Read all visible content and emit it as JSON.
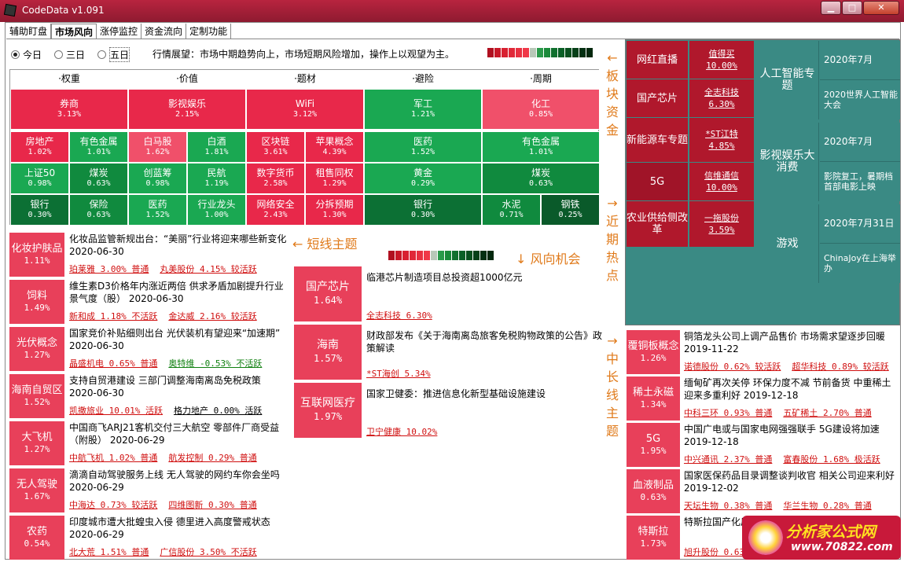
{
  "window": {
    "title": "CodeData v1.091"
  },
  "tabs": [
    "辅助盯盘",
    "市场风向",
    "涨停监控",
    "资金流向",
    "定制功能"
  ],
  "radios": [
    {
      "label": "今日",
      "on": true
    },
    {
      "label": "三日",
      "on": false
    },
    {
      "label": "五日",
      "on": false
    }
  ],
  "forecast": "行情展望：市场中期趋势向上，市场短期风险增加，操作上以观望为主。",
  "side_labels": {
    "sector_funds": "←板块资金",
    "recent_hot": "→近期热点",
    "long_theme": "→中长线主题"
  },
  "grid_headers": [
    "·权重",
    "·价值",
    "·题材",
    "·避险",
    "·周期"
  ],
  "grid_cells": [
    {
      "name": "券商",
      "pct": "3.13%",
      "color": "#e8284a"
    },
    {
      "name": "影视娱乐",
      "pct": "2.15%",
      "color": "#e8284a"
    },
    {
      "name": "WiFi",
      "pct": "3.12%",
      "color": "#e8284a"
    },
    {
      "name": "军工",
      "pct": "1.21%",
      "color": "#1aa852"
    },
    {
      "name": "化工",
      "pct": "0.85%",
      "color": "#f0506a"
    },
    {
      "name": "房地产",
      "pct": "1.02%",
      "color": "#e8284a"
    },
    {
      "name": "有色金属",
      "pct": "1.01%",
      "color": "#1aa852"
    },
    {
      "name": "白马股",
      "pct": "1.62%",
      "color": "#f0506a"
    },
    {
      "name": "白酒",
      "pct": "1.81%",
      "color": "#1aa852"
    },
    {
      "name": "区块链",
      "pct": "3.61%",
      "color": "#e8284a"
    },
    {
      "name": "苹果概念",
      "pct": "4.39%",
      "color": "#e8284a"
    },
    {
      "name": "医药",
      "pct": "1.52%",
      "color": "#1aa852"
    },
    {
      "name": "有色金属",
      "pct": "1.01%",
      "color": "#1aa852"
    },
    {
      "name": "上证50",
      "pct": "0.98%",
      "color": "#1aa852"
    },
    {
      "name": "煤炭",
      "pct": "0.63%",
      "color": "#108a3e"
    },
    {
      "name": "创蓝筹",
      "pct": "0.98%",
      "color": "#1aa852"
    },
    {
      "name": "民航",
      "pct": "1.19%",
      "color": "#1aa852"
    },
    {
      "name": "数字货币",
      "pct": "2.58%",
      "color": "#e8284a"
    },
    {
      "name": "租售同权",
      "pct": "1.29%",
      "color": "#e8284a"
    },
    {
      "name": "黄金",
      "pct": "0.29%",
      "color": "#1aa852"
    },
    {
      "name": "煤炭",
      "pct": "0.63%",
      "color": "#108a3e"
    },
    {
      "name": "银行",
      "pct": "0.30%",
      "color": "#0c7034"
    },
    {
      "name": "保险",
      "pct": "0.63%",
      "color": "#108a3e"
    },
    {
      "name": "医药",
      "pct": "1.52%",
      "color": "#1aa852"
    },
    {
      "name": "行业龙头",
      "pct": "1.00%",
      "color": "#1aa852"
    },
    {
      "name": "网络安全",
      "pct": "2.43%",
      "color": "#e8284a"
    },
    {
      "name": "分拆预期",
      "pct": "1.30%",
      "color": "#e8284a"
    },
    {
      "name": "银行",
      "pct": "0.30%",
      "color": "#0c7034"
    },
    {
      "name": "水泥",
      "pct": "0.71%",
      "color": "#108a3e"
    },
    {
      "name": "钢铁",
      "pct": "0.25%",
      "color": "#0a5a2a"
    }
  ],
  "short_title": "← 短线主题",
  "wind_title": "↓ 风向机会",
  "short_items": [
    {
      "name": "化妆护肤品",
      "pct": "1.11%",
      "headline": "化妆品监管新规出台：“美丽”行业将迎来哪些新变化 2020-06-30",
      "stocks": [
        {
          "t": "珀莱雅 3.00% 普通",
          "c": "r"
        },
        {
          "t": "丸美股份 4.15% 较活跃",
          "c": "r"
        }
      ]
    },
    {
      "name": "饲料",
      "pct": "1.49%",
      "headline": "维生素D3价格年内涨近两倍 供求矛盾加剧提升行业景气度（股） 2020-06-30",
      "stocks": [
        {
          "t": "新和成 1.18% 不活跃",
          "c": "r"
        },
        {
          "t": "金达威 2.16% 较活跃",
          "c": "r"
        }
      ]
    },
    {
      "name": "光伏概念",
      "pct": "1.27%",
      "headline": "国家竞价补贴细则出台 光伏装机有望迎来“加速期” 2020-06-30",
      "stocks": [
        {
          "t": "晶盛机电 0.65% 普通",
          "c": "r"
        },
        {
          "t": "奥特维 -0.53% 不活跃",
          "c": "g"
        }
      ]
    },
    {
      "name": "海南自贸区",
      "pct": "1.52%",
      "headline": "支持自贸港建设 三部门调整海南离岛免税政策 2020-06-30",
      "stocks": [
        {
          "t": "凯撒旅业 10.01% 活跃",
          "c": "r"
        },
        {
          "t": "格力地产 0.00% 活跃",
          "c": "k"
        }
      ]
    },
    {
      "name": "大飞机",
      "pct": "1.27%",
      "headline": "中国商飞ARJ21客机交付三大航空 零部件厂商受益（附股） 2020-06-29",
      "stocks": [
        {
          "t": "中航飞机 1.02% 普通",
          "c": "r"
        },
        {
          "t": "航发控制 0.29% 普通",
          "c": "r"
        }
      ]
    },
    {
      "name": "无人驾驶",
      "pct": "1.67%",
      "headline": "滴滴自动驾驶服务上线 无人驾驶的网约车你会坐吗 2020-06-29",
      "stocks": [
        {
          "t": "中海达 0.73% 较活跃",
          "c": "r"
        },
        {
          "t": "四维图新 0.30% 普通",
          "c": "r"
        }
      ]
    },
    {
      "name": "农药",
      "pct": "0.54%",
      "headline": "印度城市遭大批蝗虫入侵 德里进入高度警戒状态 2020-06-29",
      "stocks": [
        {
          "t": "北大荒 1.51% 普通",
          "c": "r"
        },
        {
          "t": "广信股份 3.50% 不活跃",
          "c": "r"
        }
      ]
    }
  ],
  "wind_items": [
    {
      "name": "国产芯片",
      "pct": "1.64%",
      "headline": "临港芯片制造项目总投资超1000亿元",
      "stock": "全志科技 6.30%"
    },
    {
      "name": "海南",
      "pct": "1.57%",
      "headline": "财政部发布《关于海南离岛旅客免税购物政策的公告》政策解读",
      "stock": "*ST海创 5.34%"
    },
    {
      "name": "互联网医疗",
      "pct": "1.97%",
      "headline": "国家卫健委：推进信息化新型基础设施建设",
      "stock": "卫宁健康 10.02%"
    }
  ],
  "hot": [
    {
      "name": "网红直播",
      "stock": "值得买",
      "pct": "10.00%"
    },
    {
      "name": "国产芯片",
      "stock": "全志科技",
      "pct": "6.30%"
    },
    {
      "name": "新能源车专题",
      "stock": "*ST江特",
      "pct": "4.85%"
    },
    {
      "name": "5G",
      "stock": "信维通信",
      "pct": "10.00%"
    },
    {
      "name": "农业供给侧改革",
      "stock": "一拖股份",
      "pct": "3.59%"
    }
  ],
  "themes": [
    {
      "name": "人工智能专题",
      "date": "2020年7月",
      "event": "2020世界人工智能大会"
    },
    {
      "name": "影视娱乐大消费",
      "date": "2020年7月",
      "event": "影院复工，暑期档首部电影上映"
    },
    {
      "name": "游戏",
      "date": "2020年7月31日",
      "event": "ChinaJoy在上海举办"
    }
  ],
  "long_items": [
    {
      "name": "覆铜板概念",
      "pct": "1.26%",
      "headline": "铜箔龙头公司上调产品售价 市场需求望逐步回暖 2019-11-22",
      "stocks": [
        {
          "t": "诺德股份 0.62% 较活跃",
          "c": "r"
        },
        {
          "t": "超华科技 0.89% 较活跃",
          "c": "r"
        }
      ]
    },
    {
      "name": "稀土永磁",
      "pct": "1.34%",
      "headline": "缅甸矿再次关停 环保力度不减 节前备货 中重稀土迎来多重利好 2019-12-18",
      "stocks": [
        {
          "t": "中科三环 0.93% 普通",
          "c": "r"
        },
        {
          "t": "五矿稀土 2.70% 普通",
          "c": "r"
        }
      ]
    },
    {
      "name": "5G",
      "pct": "1.95%",
      "headline": "中国广电或与国家电网强强联手 5G建设将加速 2019-12-18",
      "stocks": [
        {
          "t": "中兴通讯 2.37% 普通",
          "c": "r"
        },
        {
          "t": "富春股份 1.68% 极活跃",
          "c": "r"
        }
      ]
    },
    {
      "name": "血液制品",
      "pct": "0.63%",
      "headline": "国家医保药品目录调整谈判收官 相关公司迎来利好 2019-12-02",
      "stocks": [
        {
          "t": "天坛生物 0.38% 普通",
          "c": "r"
        },
        {
          "t": "华兰生物 0.28% 普通",
          "c": "r"
        }
      ]
    },
    {
      "name": "特斯拉",
      "pct": "1.73%",
      "headline": "特斯拉国产化后或低至19.7万元",
      "stocks": [
        {
          "t": "旭升股份 0.63",
          "c": "r"
        }
      ]
    }
  ],
  "watermark": {
    "line1": "分析家公式网",
    "line2": "www.70822.com"
  },
  "meter_colors": [
    "#b01020",
    "#c81828",
    "#d82030",
    "#e02838",
    "#e83040",
    "#f03848",
    "#b8c8b8",
    "#2a9a4a",
    "#1a8a3a",
    "#10702e",
    "#0a6026",
    "#08501e",
    "#064018",
    "#043012",
    "#03280e"
  ]
}
